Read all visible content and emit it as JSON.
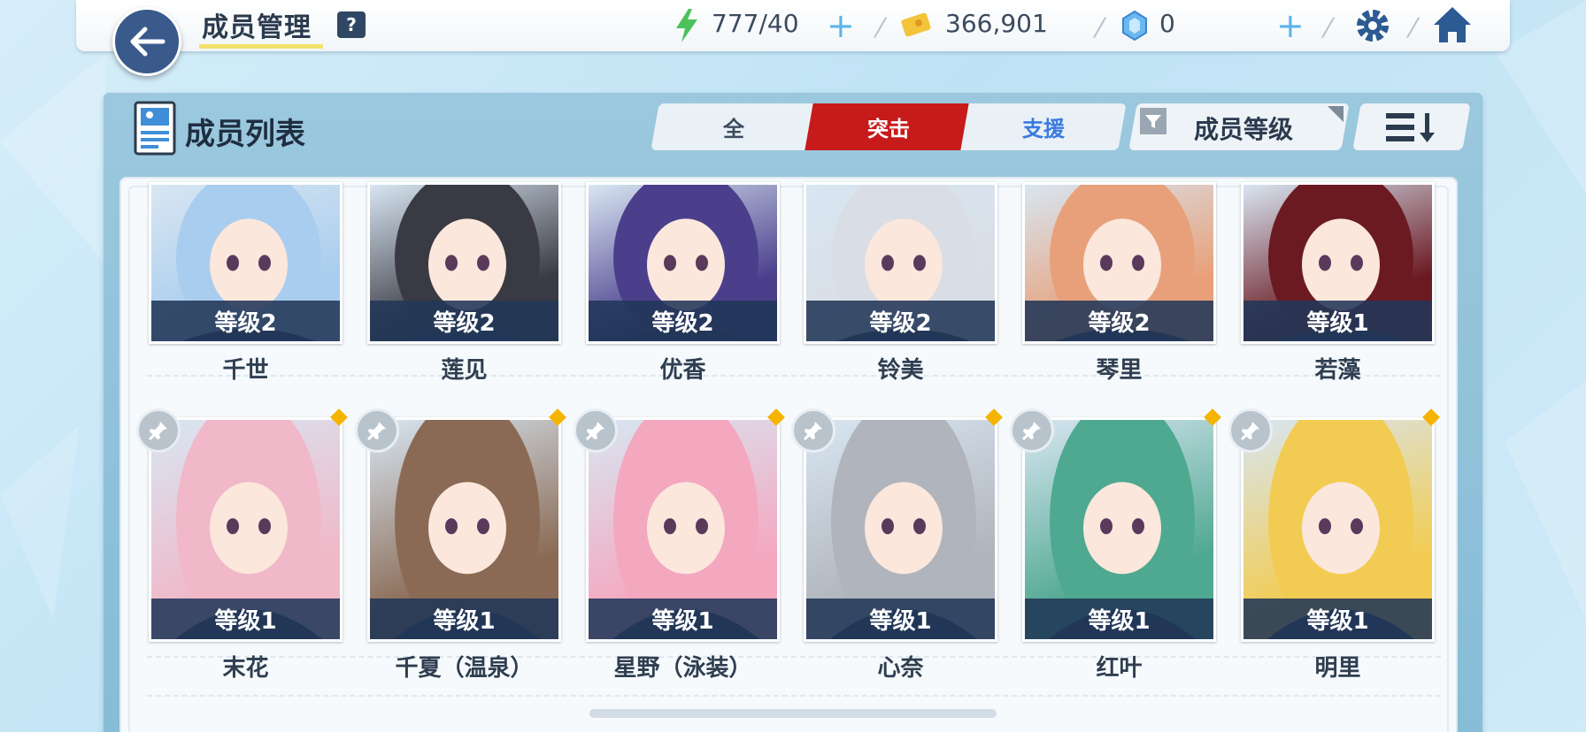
{
  "header": {
    "title": "成员管理",
    "help_label": "?",
    "stamina": "777/40",
    "credits": "366,901",
    "gems": "0"
  },
  "panel": {
    "title": "成员列表",
    "tabs": [
      {
        "label": "全"
      },
      {
        "label": "突击"
      },
      {
        "label": "支援"
      }
    ],
    "filter_label": "成员等级"
  },
  "students": [
    {
      "name": "千世",
      "level": "等级2",
      "theme": "#a9cdee"
    },
    {
      "name": "莲见",
      "level": "等级2",
      "theme": "#3a3a44"
    },
    {
      "name": "优香",
      "level": "等级2",
      "theme": "#4b3f8c"
    },
    {
      "name": "铃美",
      "level": "等级2",
      "theme": "#d9dee6"
    },
    {
      "name": "琴里",
      "level": "等级2",
      "theme": "#e8a07a"
    },
    {
      "name": "若藻",
      "level": "等级1",
      "theme": "#6b1a22"
    },
    {
      "name": "末花",
      "level": "等级1",
      "theme": "#f0b8c8"
    },
    {
      "name": "千夏（温泉）",
      "level": "等级1",
      "theme": "#8a6a54"
    },
    {
      "name": "星野（泳装）",
      "level": "等级1",
      "theme": "#f4a8c0"
    },
    {
      "name": "心奈",
      "level": "等级1",
      "theme": "#b0b4bc"
    },
    {
      "name": "红叶",
      "level": "等级1",
      "theme": "#4fa890"
    },
    {
      "name": "明里",
      "level": "等级1",
      "theme": "#f2cc52"
    }
  ]
}
